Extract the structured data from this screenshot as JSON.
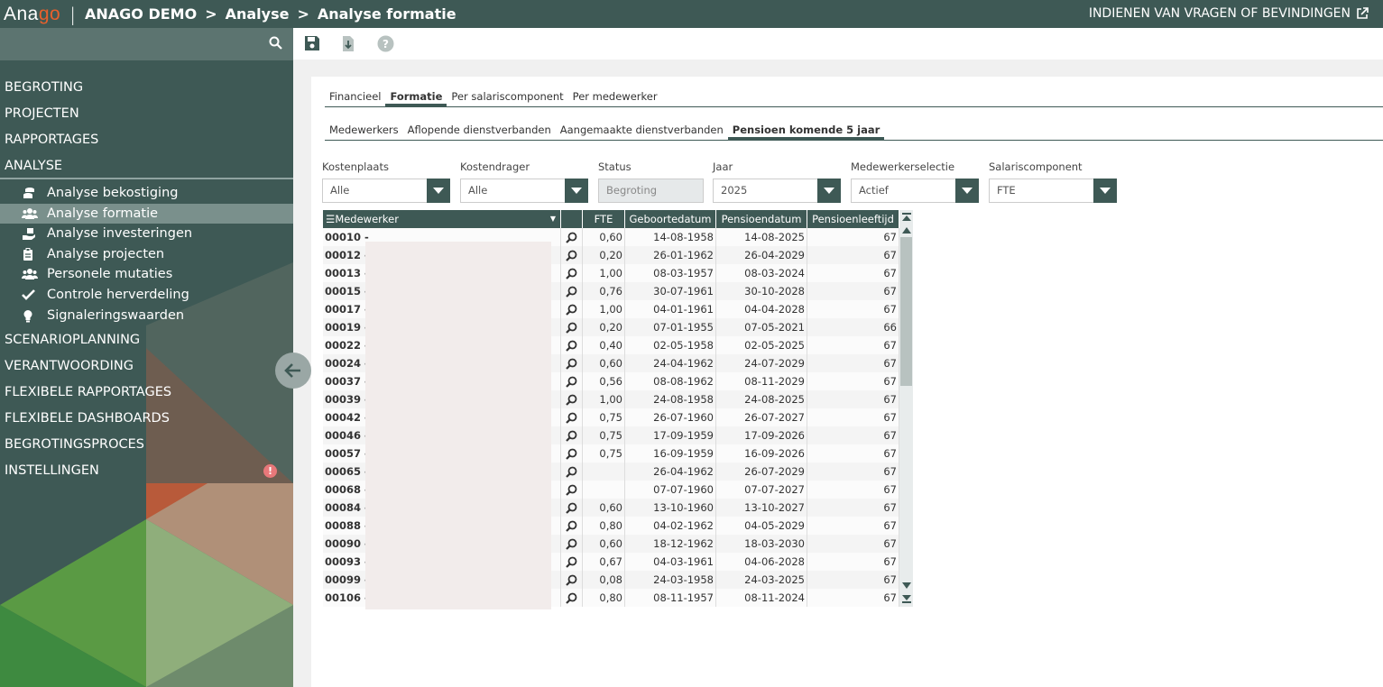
{
  "topbar": {
    "logo_part1": "Ana",
    "logo_part2": "go",
    "org": "ANAGO DEMO",
    "crumb1": "Analyse",
    "crumb2": "Analyse formatie",
    "feedback_link": "INDIENEN VAN VRAGEN OF BEVINDINGEN"
  },
  "sidebar": {
    "menu": [
      {
        "label": "BEGROTING"
      },
      {
        "label": "PROJECTEN"
      },
      {
        "label": "RAPPORTAGES"
      },
      {
        "label": "ANALYSE"
      }
    ],
    "submenu": [
      {
        "label": "Analyse bekostiging",
        "icon": "coins-icon"
      },
      {
        "label": "Analyse formatie",
        "icon": "users-icon"
      },
      {
        "label": "Analyse investeringen",
        "icon": "hand-coins-icon"
      },
      {
        "label": "Analyse projecten",
        "icon": "clipboard-icon"
      },
      {
        "label": "Personele mutaties",
        "icon": "users-icon"
      },
      {
        "label": "Controle herverdeling",
        "icon": "check-icon"
      },
      {
        "label": "Signaleringswaarden",
        "icon": "lightbulb-icon"
      }
    ],
    "menu2": [
      {
        "label": "SCENARIOPLANNING"
      },
      {
        "label": "VERANTWOORDING"
      },
      {
        "label": "FLEXIBELE RAPPORTAGES"
      },
      {
        "label": "FLEXIBELE DASHBOARDS"
      },
      {
        "label": "BEGROTINGSPROCES"
      },
      {
        "label": "INSTELLINGEN"
      }
    ],
    "alert_mark": "!"
  },
  "tabs1": [
    "Financieel",
    "Formatie",
    "Per salariscomponent",
    "Per medewerker"
  ],
  "tabs2": [
    "Medewerkers",
    "Aflopende dienstverbanden",
    "Aangemaakte dienstverbanden",
    "Pensioen komende 5 jaar"
  ],
  "filters": {
    "kostenplaats": {
      "label": "Kostenplaats",
      "value": "Alle"
    },
    "kostendrager": {
      "label": "Kostendrager",
      "value": "Alle"
    },
    "status": {
      "label": "Status",
      "value": "Begroting"
    },
    "jaar": {
      "label": "Jaar",
      "value": "2025"
    },
    "medewerkerselectie": {
      "label": "Medewerkerselectie",
      "value": "Actief"
    },
    "salariscomponent": {
      "label": "Salariscomponent",
      "value": "FTE"
    }
  },
  "grid": {
    "headers": {
      "medewerker": "Medewerker",
      "fte": "FTE",
      "geboortedatum": "Geboortedatum",
      "pensioendatum": "Pensioendatum",
      "pensioenleeftijd": "Pensioenleeftijd"
    },
    "rows": [
      {
        "id": "00010 -",
        "fte": "0,60",
        "geb": "14-08-1958",
        "pen": "14-08-2025",
        "lft": "67"
      },
      {
        "id": "00012 -",
        "fte": "0,20",
        "geb": "26-01-1962",
        "pen": "26-04-2029",
        "lft": "67"
      },
      {
        "id": "00013 -",
        "fte": "1,00",
        "geb": "08-03-1957",
        "pen": "08-03-2024",
        "lft": "67"
      },
      {
        "id": "00015 -",
        "fte": "0,76",
        "geb": "30-07-1961",
        "pen": "30-10-2028",
        "lft": "67"
      },
      {
        "id": "00017 -",
        "fte": "1,00",
        "geb": "04-01-1961",
        "pen": "04-04-2028",
        "lft": "67"
      },
      {
        "id": "00019 -",
        "fte": "0,20",
        "geb": "07-01-1955",
        "pen": "07-05-2021",
        "lft": "66"
      },
      {
        "id": "00022 -",
        "fte": "0,40",
        "geb": "02-05-1958",
        "pen": "02-05-2025",
        "lft": "67"
      },
      {
        "id": "00024 -",
        "fte": "0,60",
        "geb": "24-04-1962",
        "pen": "24-07-2029",
        "lft": "67"
      },
      {
        "id": "00037 -",
        "fte": "0,56",
        "geb": "08-08-1962",
        "pen": "08-11-2029",
        "lft": "67"
      },
      {
        "id": "00039 -",
        "fte": "1,00",
        "geb": "24-08-1958",
        "pen": "24-08-2025",
        "lft": "67"
      },
      {
        "id": "00042 -",
        "fte": "0,75",
        "geb": "26-07-1960",
        "pen": "26-07-2027",
        "lft": "67"
      },
      {
        "id": "00046 -",
        "fte": "0,75",
        "geb": "17-09-1959",
        "pen": "17-09-2026",
        "lft": "67"
      },
      {
        "id": "00057 -",
        "fte": "0,75",
        "geb": "16-09-1959",
        "pen": "16-09-2026",
        "lft": "67"
      },
      {
        "id": "00065 -",
        "fte": "",
        "geb": "26-04-1962",
        "pen": "26-07-2029",
        "lft": "67"
      },
      {
        "id": "00068 -",
        "fte": "",
        "geb": "07-07-1960",
        "pen": "07-07-2027",
        "lft": "67"
      },
      {
        "id": "00084 -",
        "fte": "0,60",
        "geb": "13-10-1960",
        "pen": "13-10-2027",
        "lft": "67"
      },
      {
        "id": "00088 -",
        "fte": "0,80",
        "geb": "04-02-1962",
        "pen": "04-05-2029",
        "lft": "67"
      },
      {
        "id": "00090 -",
        "fte": "0,60",
        "geb": "18-12-1962",
        "pen": "18-03-2030",
        "lft": "67"
      },
      {
        "id": "00093 -",
        "fte": "0,67",
        "geb": "04-03-1961",
        "pen": "04-06-2028",
        "lft": "67"
      },
      {
        "id": "00099 -",
        "fte": "0,08",
        "geb": "24-03-1958",
        "pen": "24-03-2025",
        "lft": "67"
      },
      {
        "id": "00106 -",
        "fte": "0,80",
        "geb": "08-11-1957",
        "pen": "08-11-2024",
        "lft": "67"
      }
    ]
  }
}
